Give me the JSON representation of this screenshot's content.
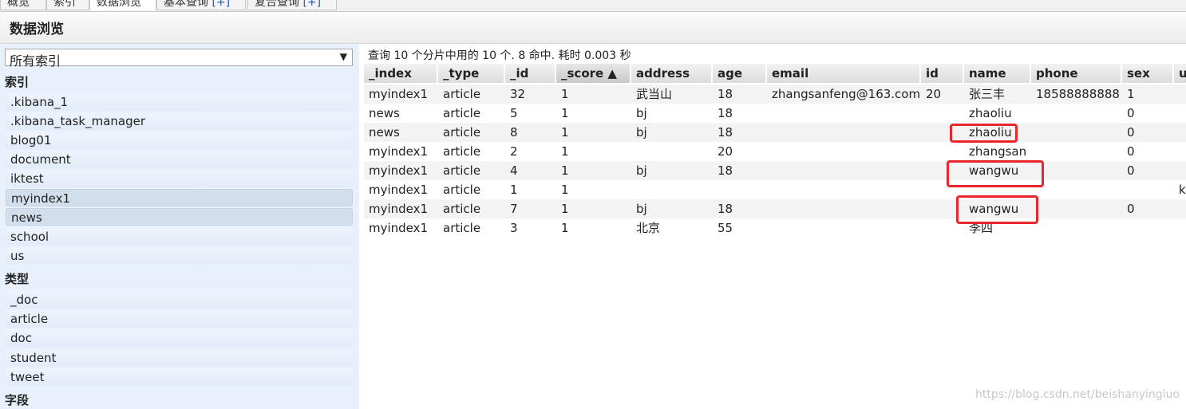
{
  "tabs": [
    {
      "label": "概览",
      "plus": ""
    },
    {
      "label": "索引",
      "plus": ""
    },
    {
      "label": "数据浏览",
      "plus": ""
    },
    {
      "label": "基本查询",
      "plus": "[+]"
    },
    {
      "label": "复合查询",
      "plus": "[+]"
    }
  ],
  "page_title": "数据浏览",
  "sidebar": {
    "select_value": "所有索引",
    "sections": {
      "indices": "索引",
      "types": "类型",
      "fields": "字段"
    },
    "indices": [
      ".kibana_1",
      ".kibana_task_manager",
      "blog01",
      "document",
      "iktest",
      "myindex1",
      "news",
      "school",
      "us"
    ],
    "types": [
      "_doc",
      "article",
      "doc",
      "student",
      "tweet"
    ]
  },
  "main": {
    "summary": "查询 10 个分片中用的 10 个. 8 命中. 耗时 0.003 秒",
    "columns": [
      "_index",
      "_type",
      "_id",
      "_score ▲",
      "address",
      "age",
      "email",
      "id",
      "name",
      "phone",
      "sex",
      "u"
    ],
    "rows": [
      [
        "myindex1",
        "article",
        "32",
        "1",
        "武当山",
        "18",
        "zhangsanfeng@163.com",
        "20",
        "张三丰",
        "18588888888",
        "1",
        ""
      ],
      [
        "news",
        "article",
        "5",
        "1",
        "bj",
        "18",
        "",
        "",
        "zhaoliu",
        "",
        "0",
        ""
      ],
      [
        "news",
        "article",
        "8",
        "1",
        "bj",
        "18",
        "",
        "",
        "zhaoliu",
        "",
        "0",
        ""
      ],
      [
        "myindex1",
        "article",
        "2",
        "1",
        "",
        "20",
        "",
        "",
        "zhangsan",
        "",
        "0",
        ""
      ],
      [
        "myindex1",
        "article",
        "4",
        "1",
        "bj",
        "18",
        "",
        "",
        "wangwu",
        "",
        "0",
        ""
      ],
      [
        "myindex1",
        "article",
        "1",
        "1",
        "",
        "",
        "",
        "",
        "",
        "",
        "",
        "kir"
      ],
      [
        "myindex1",
        "article",
        "7",
        "1",
        "bj",
        "18",
        "",
        "",
        "wangwu",
        "",
        "0",
        ""
      ],
      [
        "myindex1",
        "article",
        "3",
        "1",
        "北京",
        "55",
        "",
        "",
        "李四",
        "",
        "",
        ""
      ]
    ]
  },
  "watermark": "https://blog.csdn.net/beishanyingluo",
  "colors": {
    "highlight": "#e8262b",
    "sidebar_bg": "#e8f0fb"
  }
}
